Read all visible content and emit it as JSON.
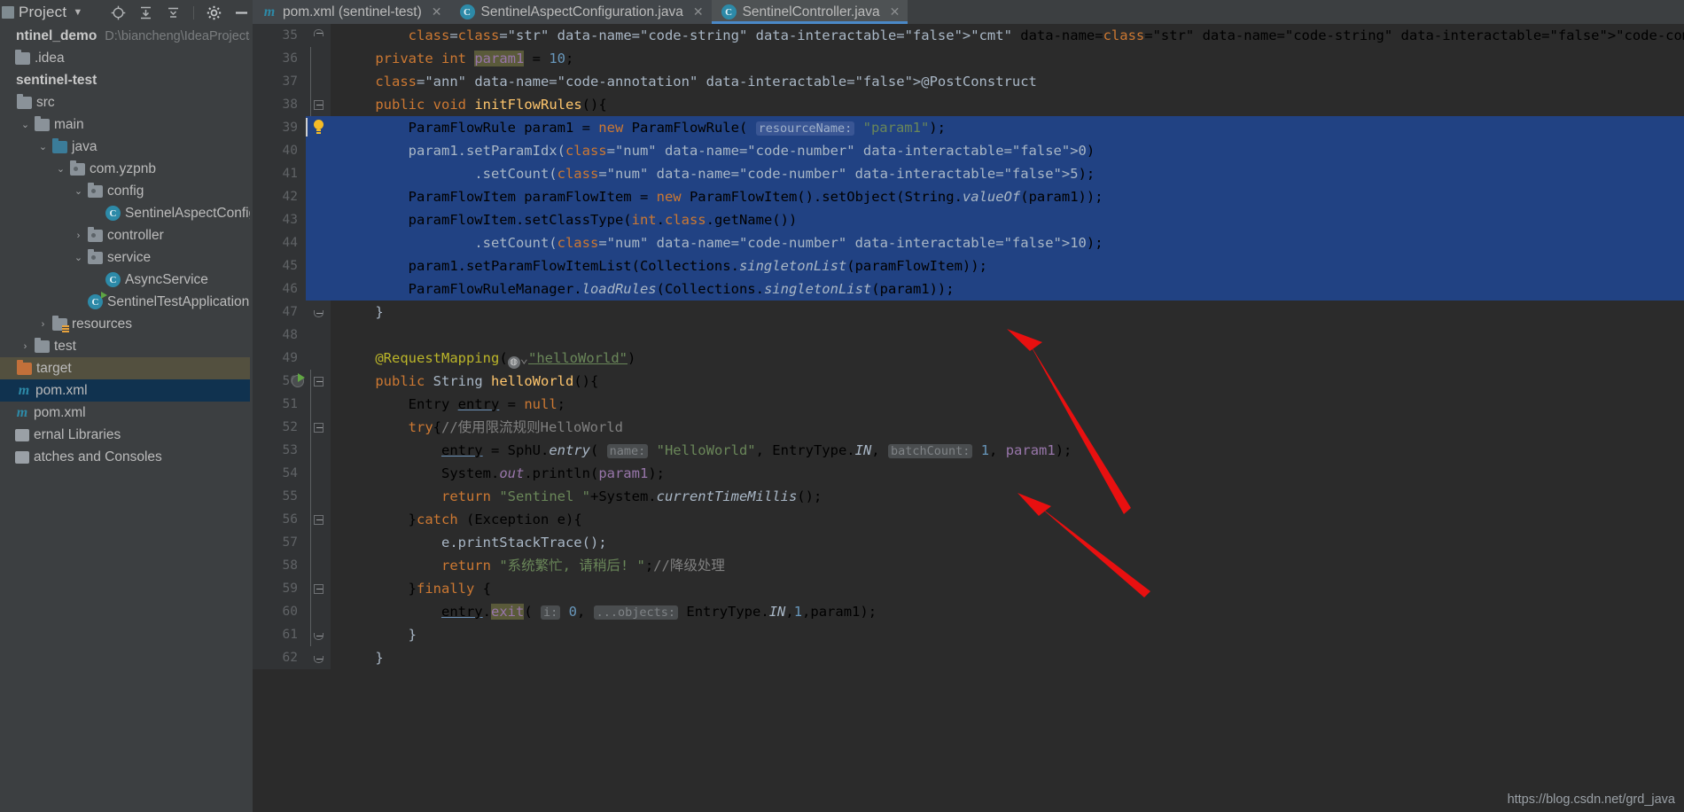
{
  "window": {
    "tool_window_title": "Project",
    "toolbar_icons": [
      "locate-icon",
      "collapse-all-icon",
      "expand-all-icon",
      "gear-icon",
      "minimize-icon"
    ]
  },
  "sidebar": {
    "items": [
      {
        "label": "ntinel_demo",
        "detail": "D:\\biancheng\\IdeaProjects\\",
        "icon": "project-icon",
        "twisty": "",
        "indent": 0,
        "bold": true,
        "state": "normal"
      },
      {
        "label": ".idea",
        "detail": "",
        "icon": "folder-icon",
        "twisty": "",
        "indent": 0,
        "bold": false,
        "state": "normal"
      },
      {
        "label": "sentinel-test",
        "detail": "",
        "icon": "module-icon",
        "twisty": "",
        "indent": 0,
        "bold": true,
        "state": "normal"
      },
      {
        "label": "src",
        "detail": "",
        "icon": "folder-icon",
        "twisty": "",
        "indent": 1,
        "bold": false,
        "state": "normal"
      },
      {
        "label": "main",
        "detail": "",
        "icon": "folder-icon",
        "twisty": "expanded",
        "indent": 2,
        "bold": false,
        "state": "normal"
      },
      {
        "label": "java",
        "detail": "",
        "icon": "source-folder-icon",
        "twisty": "expanded",
        "indent": 3,
        "bold": false,
        "state": "normal"
      },
      {
        "label": "com.yzpnb",
        "detail": "",
        "icon": "package-icon",
        "twisty": "expanded",
        "indent": 4,
        "bold": false,
        "state": "normal"
      },
      {
        "label": "config",
        "detail": "",
        "icon": "package-icon",
        "twisty": "expanded",
        "indent": 5,
        "bold": false,
        "state": "normal"
      },
      {
        "label": "SentinelAspectConfig",
        "detail": "",
        "icon": "java-class-icon",
        "twisty": "",
        "indent": 6,
        "bold": false,
        "state": "normal"
      },
      {
        "label": "controller",
        "detail": "",
        "icon": "package-icon",
        "twisty": "collapsed",
        "indent": 5,
        "bold": false,
        "state": "normal"
      },
      {
        "label": "service",
        "detail": "",
        "icon": "package-icon",
        "twisty": "expanded",
        "indent": 5,
        "bold": false,
        "state": "normal"
      },
      {
        "label": "AsyncService",
        "detail": "",
        "icon": "java-class-icon",
        "twisty": "",
        "indent": 6,
        "bold": false,
        "state": "normal"
      },
      {
        "label": "SentinelTestApplication",
        "detail": "",
        "icon": "java-runnable-class-icon",
        "twisty": "",
        "indent": 5,
        "bold": false,
        "state": "normal"
      },
      {
        "label": "resources",
        "detail": "",
        "icon": "resources-folder-icon",
        "twisty": "collapsed",
        "indent": 3,
        "bold": false,
        "state": "normal"
      },
      {
        "label": "test",
        "detail": "",
        "icon": "folder-icon",
        "twisty": "collapsed",
        "indent": 2,
        "bold": false,
        "state": "normal"
      },
      {
        "label": "target",
        "detail": "",
        "icon": "excluded-folder-icon",
        "twisty": "",
        "indent": 1,
        "bold": false,
        "state": "selected-inactive"
      },
      {
        "label": "pom.xml",
        "detail": "",
        "icon": "maven-icon",
        "twisty": "",
        "indent": 1,
        "bold": false,
        "state": "selected"
      },
      {
        "label": "pom.xml",
        "detail": "",
        "icon": "maven-icon",
        "twisty": "",
        "indent": 0,
        "bold": false,
        "state": "normal"
      },
      {
        "label": "ernal Libraries",
        "detail": "",
        "icon": "libraries-icon",
        "twisty": "",
        "indent": 0,
        "bold": false,
        "state": "normal"
      },
      {
        "label": "atches and Consoles",
        "detail": "",
        "icon": "scratches-icon",
        "twisty": "",
        "indent": 0,
        "bold": false,
        "state": "normal"
      }
    ]
  },
  "tabs": [
    {
      "label": "pom.xml (sentinel-test)",
      "icon": "maven-icon",
      "active": false,
      "closable": true
    },
    {
      "label": "SentinelAspectConfiguration.java",
      "icon": "java-class-icon",
      "active": false,
      "closable": true
    },
    {
      "label": "SentinelController.java",
      "icon": "java-class-icon",
      "active": true,
      "closable": true
    }
  ],
  "editor": {
    "file": "SentinelController.java",
    "first_line_number": 35,
    "selection_start_line": 39,
    "selection_end_line": 46,
    "lines": [
      {
        "n": 35,
        "fold": "top",
        "marker": "",
        "sel": false,
        "indent": 2,
        "text": "*/"
      },
      {
        "n": 36,
        "fold": "",
        "marker": "",
        "sel": false,
        "indent": 1,
        "text": "private int param1 = 10;"
      },
      {
        "n": 37,
        "fold": "",
        "marker": "",
        "sel": false,
        "indent": 1,
        "text": "@PostConstruct"
      },
      {
        "n": 38,
        "fold": "box",
        "marker": "",
        "sel": false,
        "indent": 1,
        "text": "public void initFlowRules(){"
      },
      {
        "n": 39,
        "fold": "",
        "marker": "bulb",
        "sel": true,
        "indent": 2,
        "text": "ParamFlowRule param1 = new ParamFlowRule( resourceName: \"param1\");"
      },
      {
        "n": 40,
        "fold": "",
        "marker": "",
        "sel": true,
        "indent": 2,
        "text": "param1.setParamIdx(0)"
      },
      {
        "n": 41,
        "fold": "",
        "marker": "",
        "sel": true,
        "indent": 4,
        "text": ".setCount(5);"
      },
      {
        "n": 42,
        "fold": "",
        "marker": "",
        "sel": true,
        "indent": 2,
        "text": "ParamFlowItem paramFlowItem = new ParamFlowItem().setObject(String.valueOf(param1));"
      },
      {
        "n": 43,
        "fold": "",
        "marker": "",
        "sel": true,
        "indent": 2,
        "text": "paramFlowItem.setClassType(int.class.getName())"
      },
      {
        "n": 44,
        "fold": "",
        "marker": "",
        "sel": true,
        "indent": 4,
        "text": ".setCount(10);"
      },
      {
        "n": 45,
        "fold": "",
        "marker": "",
        "sel": true,
        "indent": 2,
        "text": "param1.setParamFlowItemList(Collections.singletonList(paramFlowItem));"
      },
      {
        "n": 46,
        "fold": "",
        "marker": "",
        "sel": true,
        "indent": 2,
        "text": "ParamFlowRuleManager.loadRules(Collections.singletonList(param1));"
      },
      {
        "n": 47,
        "fold": "bottom",
        "marker": "",
        "sel": false,
        "indent": 1,
        "text": "}"
      },
      {
        "n": 48,
        "fold": "",
        "marker": "",
        "sel": false,
        "indent": 0,
        "text": ""
      },
      {
        "n": 49,
        "fold": "",
        "marker": "",
        "sel": false,
        "indent": 1,
        "text": "@RequestMapping(\"helloWorld\")"
      },
      {
        "n": 50,
        "fold": "box",
        "marker": "run",
        "sel": false,
        "indent": 1,
        "text": "public String helloWorld(){"
      },
      {
        "n": 51,
        "fold": "",
        "marker": "",
        "sel": false,
        "indent": 2,
        "text": "Entry entry = null;"
      },
      {
        "n": 52,
        "fold": "box",
        "marker": "",
        "sel": false,
        "indent": 2,
        "text": "try{//使用限流规则HelloWorld"
      },
      {
        "n": 53,
        "fold": "",
        "marker": "",
        "sel": false,
        "indent": 3,
        "text": "entry = SphU.entry( name: \"HelloWorld\", EntryType.IN, batchCount: 1, param1);"
      },
      {
        "n": 54,
        "fold": "",
        "marker": "",
        "sel": false,
        "indent": 3,
        "text": "System.out.println(param1);"
      },
      {
        "n": 55,
        "fold": "",
        "marker": "",
        "sel": false,
        "indent": 3,
        "text": "return \"Sentinel \"+System.currentTimeMillis();"
      },
      {
        "n": 56,
        "fold": "box",
        "marker": "",
        "sel": false,
        "indent": 2,
        "text": "}catch (Exception e){"
      },
      {
        "n": 57,
        "fold": "",
        "marker": "",
        "sel": false,
        "indent": 3,
        "text": "e.printStackTrace();"
      },
      {
        "n": 58,
        "fold": "",
        "marker": "",
        "sel": false,
        "indent": 3,
        "text": "return \"系统繁忙, 请稍后! \";//降级处理"
      },
      {
        "n": 59,
        "fold": "box",
        "marker": "",
        "sel": false,
        "indent": 2,
        "text": "}finally {"
      },
      {
        "n": 60,
        "fold": "",
        "marker": "",
        "sel": false,
        "indent": 3,
        "text": "entry.exit( i: 0, ...objects: EntryType.IN,1,param1);"
      },
      {
        "n": 61,
        "fold": "bottom",
        "marker": "",
        "sel": false,
        "indent": 2,
        "text": "}"
      },
      {
        "n": 62,
        "fold": "bottom",
        "marker": "",
        "sel": false,
        "indent": 1,
        "text": "}"
      }
    ]
  },
  "watermark": "https://blog.csdn.net/grd_java",
  "colors": {
    "editor_bg": "#2b2b2b",
    "gutter_bg": "#313335",
    "selection_bg": "#214283",
    "ide_bg": "#3c3f41",
    "accent_tab": "#4a88c7",
    "keyword": "#cc7832",
    "string": "#6a8759",
    "number": "#6897bb",
    "annotation": "#bbb529",
    "method": "#ffc66d",
    "field": "#9876aa",
    "comment": "#808080",
    "arrow": "#e81010"
  }
}
